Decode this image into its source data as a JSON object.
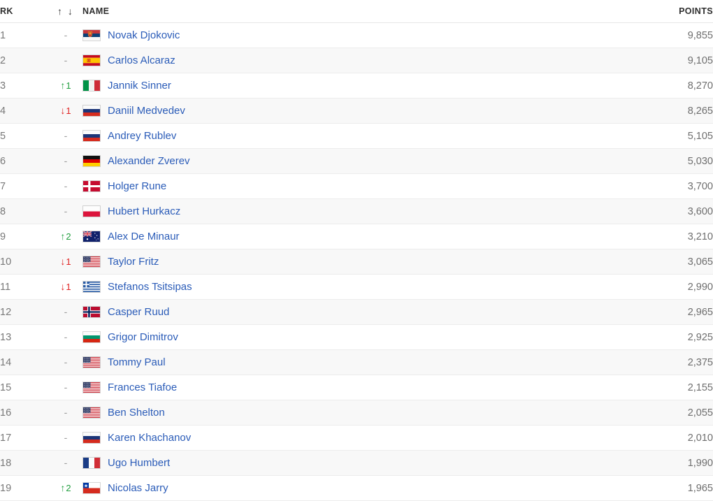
{
  "table": {
    "headers": {
      "rank": "RK",
      "movement": "↑ ↓",
      "name": "NAME",
      "points": "POINTS"
    },
    "rows": [
      {
        "rank": "1",
        "move_dir": "none",
        "move": "-",
        "flag": "serbia",
        "name": "Novak Djokovic",
        "points": "9,855"
      },
      {
        "rank": "2",
        "move_dir": "none",
        "move": "-",
        "flag": "spain",
        "name": "Carlos Alcaraz",
        "points": "9,105"
      },
      {
        "rank": "3",
        "move_dir": "up",
        "move": "1",
        "flag": "italy",
        "name": "Jannik Sinner",
        "points": "8,270"
      },
      {
        "rank": "4",
        "move_dir": "down",
        "move": "1",
        "flag": "russia",
        "name": "Daniil Medvedev",
        "points": "8,265"
      },
      {
        "rank": "5",
        "move_dir": "none",
        "move": "-",
        "flag": "russia",
        "name": "Andrey Rublev",
        "points": "5,105"
      },
      {
        "rank": "6",
        "move_dir": "none",
        "move": "-",
        "flag": "germany",
        "name": "Alexander Zverev",
        "points": "5,030"
      },
      {
        "rank": "7",
        "move_dir": "none",
        "move": "-",
        "flag": "denmark",
        "name": "Holger Rune",
        "points": "3,700"
      },
      {
        "rank": "8",
        "move_dir": "none",
        "move": "-",
        "flag": "poland",
        "name": "Hubert Hurkacz",
        "points": "3,600"
      },
      {
        "rank": "9",
        "move_dir": "up",
        "move": "2",
        "flag": "australia",
        "name": "Alex De Minaur",
        "points": "3,210"
      },
      {
        "rank": "10",
        "move_dir": "down",
        "move": "1",
        "flag": "usa",
        "name": "Taylor Fritz",
        "points": "3,065"
      },
      {
        "rank": "11",
        "move_dir": "down",
        "move": "1",
        "flag": "greece",
        "name": "Stefanos Tsitsipas",
        "points": "2,990"
      },
      {
        "rank": "12",
        "move_dir": "none",
        "move": "-",
        "flag": "norway",
        "name": "Casper Ruud",
        "points": "2,965"
      },
      {
        "rank": "13",
        "move_dir": "none",
        "move": "-",
        "flag": "bulgaria",
        "name": "Grigor Dimitrov",
        "points": "2,925"
      },
      {
        "rank": "14",
        "move_dir": "none",
        "move": "-",
        "flag": "usa",
        "name": "Tommy Paul",
        "points": "2,375"
      },
      {
        "rank": "15",
        "move_dir": "none",
        "move": "-",
        "flag": "usa",
        "name": "Frances Tiafoe",
        "points": "2,155"
      },
      {
        "rank": "16",
        "move_dir": "none",
        "move": "-",
        "flag": "usa",
        "name": "Ben Shelton",
        "points": "2,055"
      },
      {
        "rank": "17",
        "move_dir": "none",
        "move": "-",
        "flag": "russia",
        "name": "Karen Khachanov",
        "points": "2,010"
      },
      {
        "rank": "18",
        "move_dir": "none",
        "move": "-",
        "flag": "france",
        "name": "Ugo Humbert",
        "points": "1,990"
      },
      {
        "rank": "19",
        "move_dir": "up",
        "move": "2",
        "flag": "chile",
        "name": "Nicolas Jarry",
        "points": "1,965"
      }
    ]
  },
  "colors": {
    "link": "#2b5cb8",
    "up": "#1f9d3d",
    "down": "#e02020",
    "muted": "#9a9a9a",
    "row_alt": "#f8f8f8"
  },
  "icons": {
    "arrow_up": "↑",
    "arrow_down": "↓",
    "dash": "-"
  }
}
